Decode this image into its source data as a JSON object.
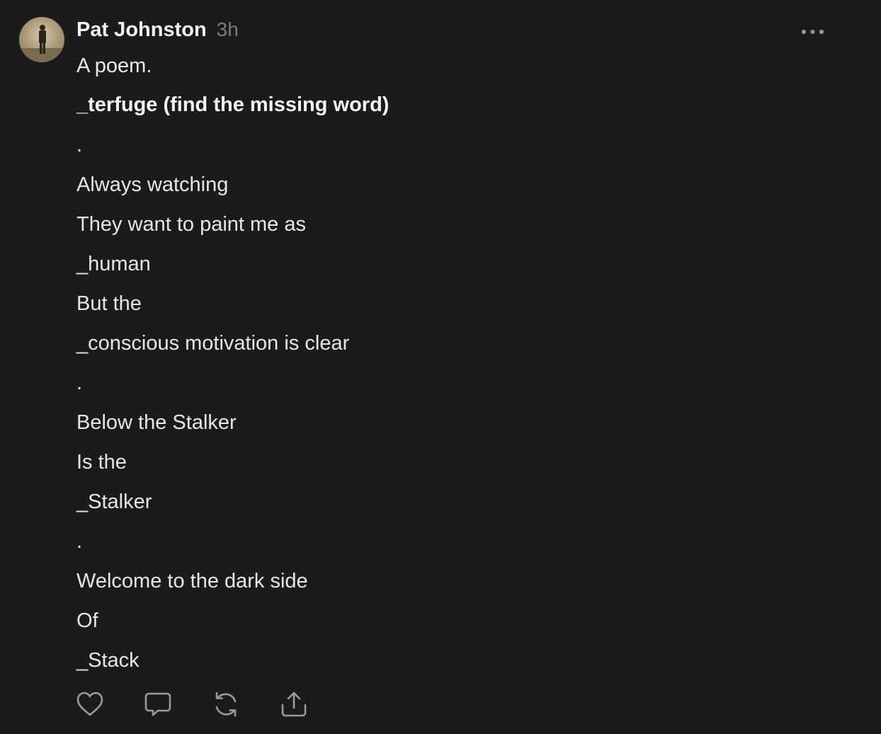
{
  "post": {
    "author": "Pat Johnston",
    "time": "3h",
    "intro": "A poem.",
    "title": "_terfuge (find the missing word)",
    "lines": [
      ".",
      "Always watching",
      "They want to paint me as",
      "_human",
      "But the",
      "_conscious motivation is clear",
      ".",
      "Below the Stalker",
      "Is the",
      "_Stalker",
      ".",
      "Welcome to the dark side",
      "Of",
      "_Stack"
    ]
  },
  "icons": {
    "more": "more-horizontal-icon",
    "like": "heart-icon",
    "comment": "speech-bubble-icon",
    "restack": "restack-arrows-icon",
    "share": "share-upload-icon"
  },
  "colors": {
    "background": "#1a1b1d",
    "text": "#e9e9ea",
    "muted": "#7b7c80",
    "icon": "#9a9b9f"
  }
}
